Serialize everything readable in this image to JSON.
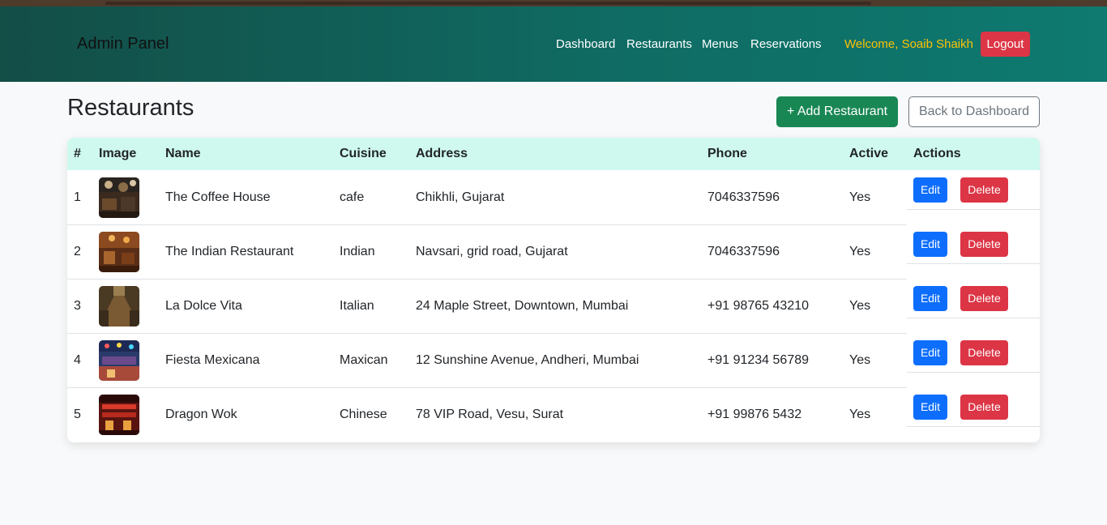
{
  "navbar": {
    "brand": "Admin Panel",
    "links": [
      "Dashboard",
      "Restaurants",
      "Menus",
      "Reservations"
    ],
    "welcome": "Welcome, Soaib Shaikh",
    "logout_label": "Logout"
  },
  "page": {
    "title": "Restaurants",
    "add_label": "+ Add Restaurant",
    "back_label": "Back to Dashboard"
  },
  "table": {
    "headers": [
      "#",
      "Image",
      "Name",
      "Cuisine",
      "Address",
      "Phone",
      "Active",
      "Actions"
    ],
    "edit_label": "Edit",
    "delete_label": "Delete",
    "rows": [
      {
        "num": "1",
        "name": "The Coffee House",
        "cuisine": "cafe",
        "address": "Chikhli, Gujarat",
        "phone": "7046337596",
        "active": "Yes",
        "image": "restaurant-photo"
      },
      {
        "num": "2",
        "name": "The Indian Restaurant",
        "cuisine": "Indian",
        "address": "Navsari, grid road, Gujarat",
        "phone": "7046337596",
        "active": "Yes",
        "image": "restaurant-photo"
      },
      {
        "num": "3",
        "name": "La Dolce Vita",
        "cuisine": "Italian",
        "address": "24 Maple Street, Downtown, Mumbai",
        "phone": "+91 98765 43210",
        "active": "Yes",
        "image": "restaurant-photo"
      },
      {
        "num": "4",
        "name": "Fiesta Mexicana",
        "cuisine": "Maxican",
        "address": "12 Sunshine Avenue, Andheri, Mumbai",
        "phone": "+91 91234 56789",
        "active": "Yes",
        "image": "restaurant-photo"
      },
      {
        "num": "5",
        "name": "Dragon Wok",
        "cuisine": "Chinese",
        "address": "78 VIP Road, Vesu, Surat",
        "phone": "+91 99876 5432",
        "active": "Yes",
        "image": "restaurant-photo"
      }
    ]
  },
  "colors": {
    "nav_start": "#134e47",
    "nav_end": "#0e7a70",
    "welcome": "#ffc107",
    "danger": "#dc3545",
    "success": "#198754",
    "primary": "#0d6efd",
    "table_header": "#cff9ee"
  }
}
